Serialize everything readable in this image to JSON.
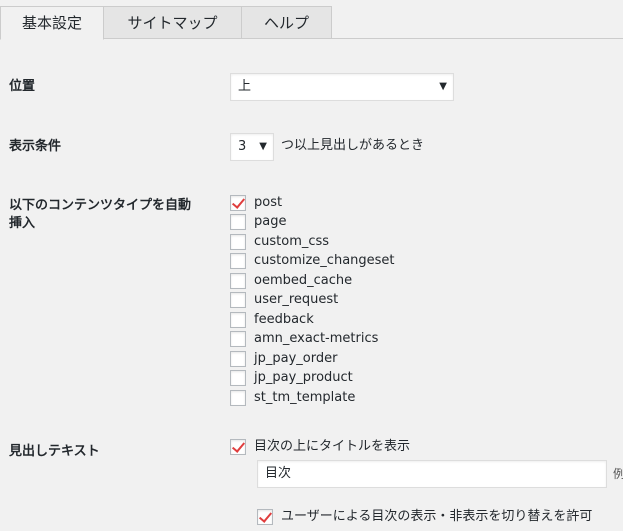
{
  "tabs": [
    {
      "label": "基本設定",
      "active": true
    },
    {
      "label": "サイトマップ",
      "active": false
    },
    {
      "label": "ヘルプ",
      "active": false
    }
  ],
  "position": {
    "label": "位置",
    "value": "上"
  },
  "display_condition": {
    "label": "表示条件",
    "value": "3",
    "suffix": "つ以上見出しがあるとき"
  },
  "content_types": {
    "label_line1": "以下のコンテンツタイプを自動",
    "label_line2": "挿入",
    "items": [
      {
        "label": "post",
        "checked": true
      },
      {
        "label": "page",
        "checked": false
      },
      {
        "label": "custom_css",
        "checked": false
      },
      {
        "label": "customize_changeset",
        "checked": false
      },
      {
        "label": "oembed_cache",
        "checked": false
      },
      {
        "label": "user_request",
        "checked": false
      },
      {
        "label": "feedback",
        "checked": false
      },
      {
        "label": "amn_exact-metrics",
        "checked": false
      },
      {
        "label": "jp_pay_order",
        "checked": false
      },
      {
        "label": "jp_pay_product",
        "checked": false
      },
      {
        "label": "st_tm_template",
        "checked": false
      }
    ]
  },
  "heading_text": {
    "label": "見出しテキスト",
    "show_title_label": "目次の上にタイトルを表示",
    "show_title_checked": true,
    "title_value": "目次",
    "edge_text": "例",
    "toggle_label": "ユーザーによる目次の表示・非表示を切り替えを許可",
    "toggle_checked": true
  },
  "colors": {
    "check": "#e03e3e",
    "background": "#f1f1f1",
    "border": "#cccccc"
  },
  "icons": {
    "select_arrow": "caret-down-icon",
    "checkbox": "checkmark-icon"
  }
}
